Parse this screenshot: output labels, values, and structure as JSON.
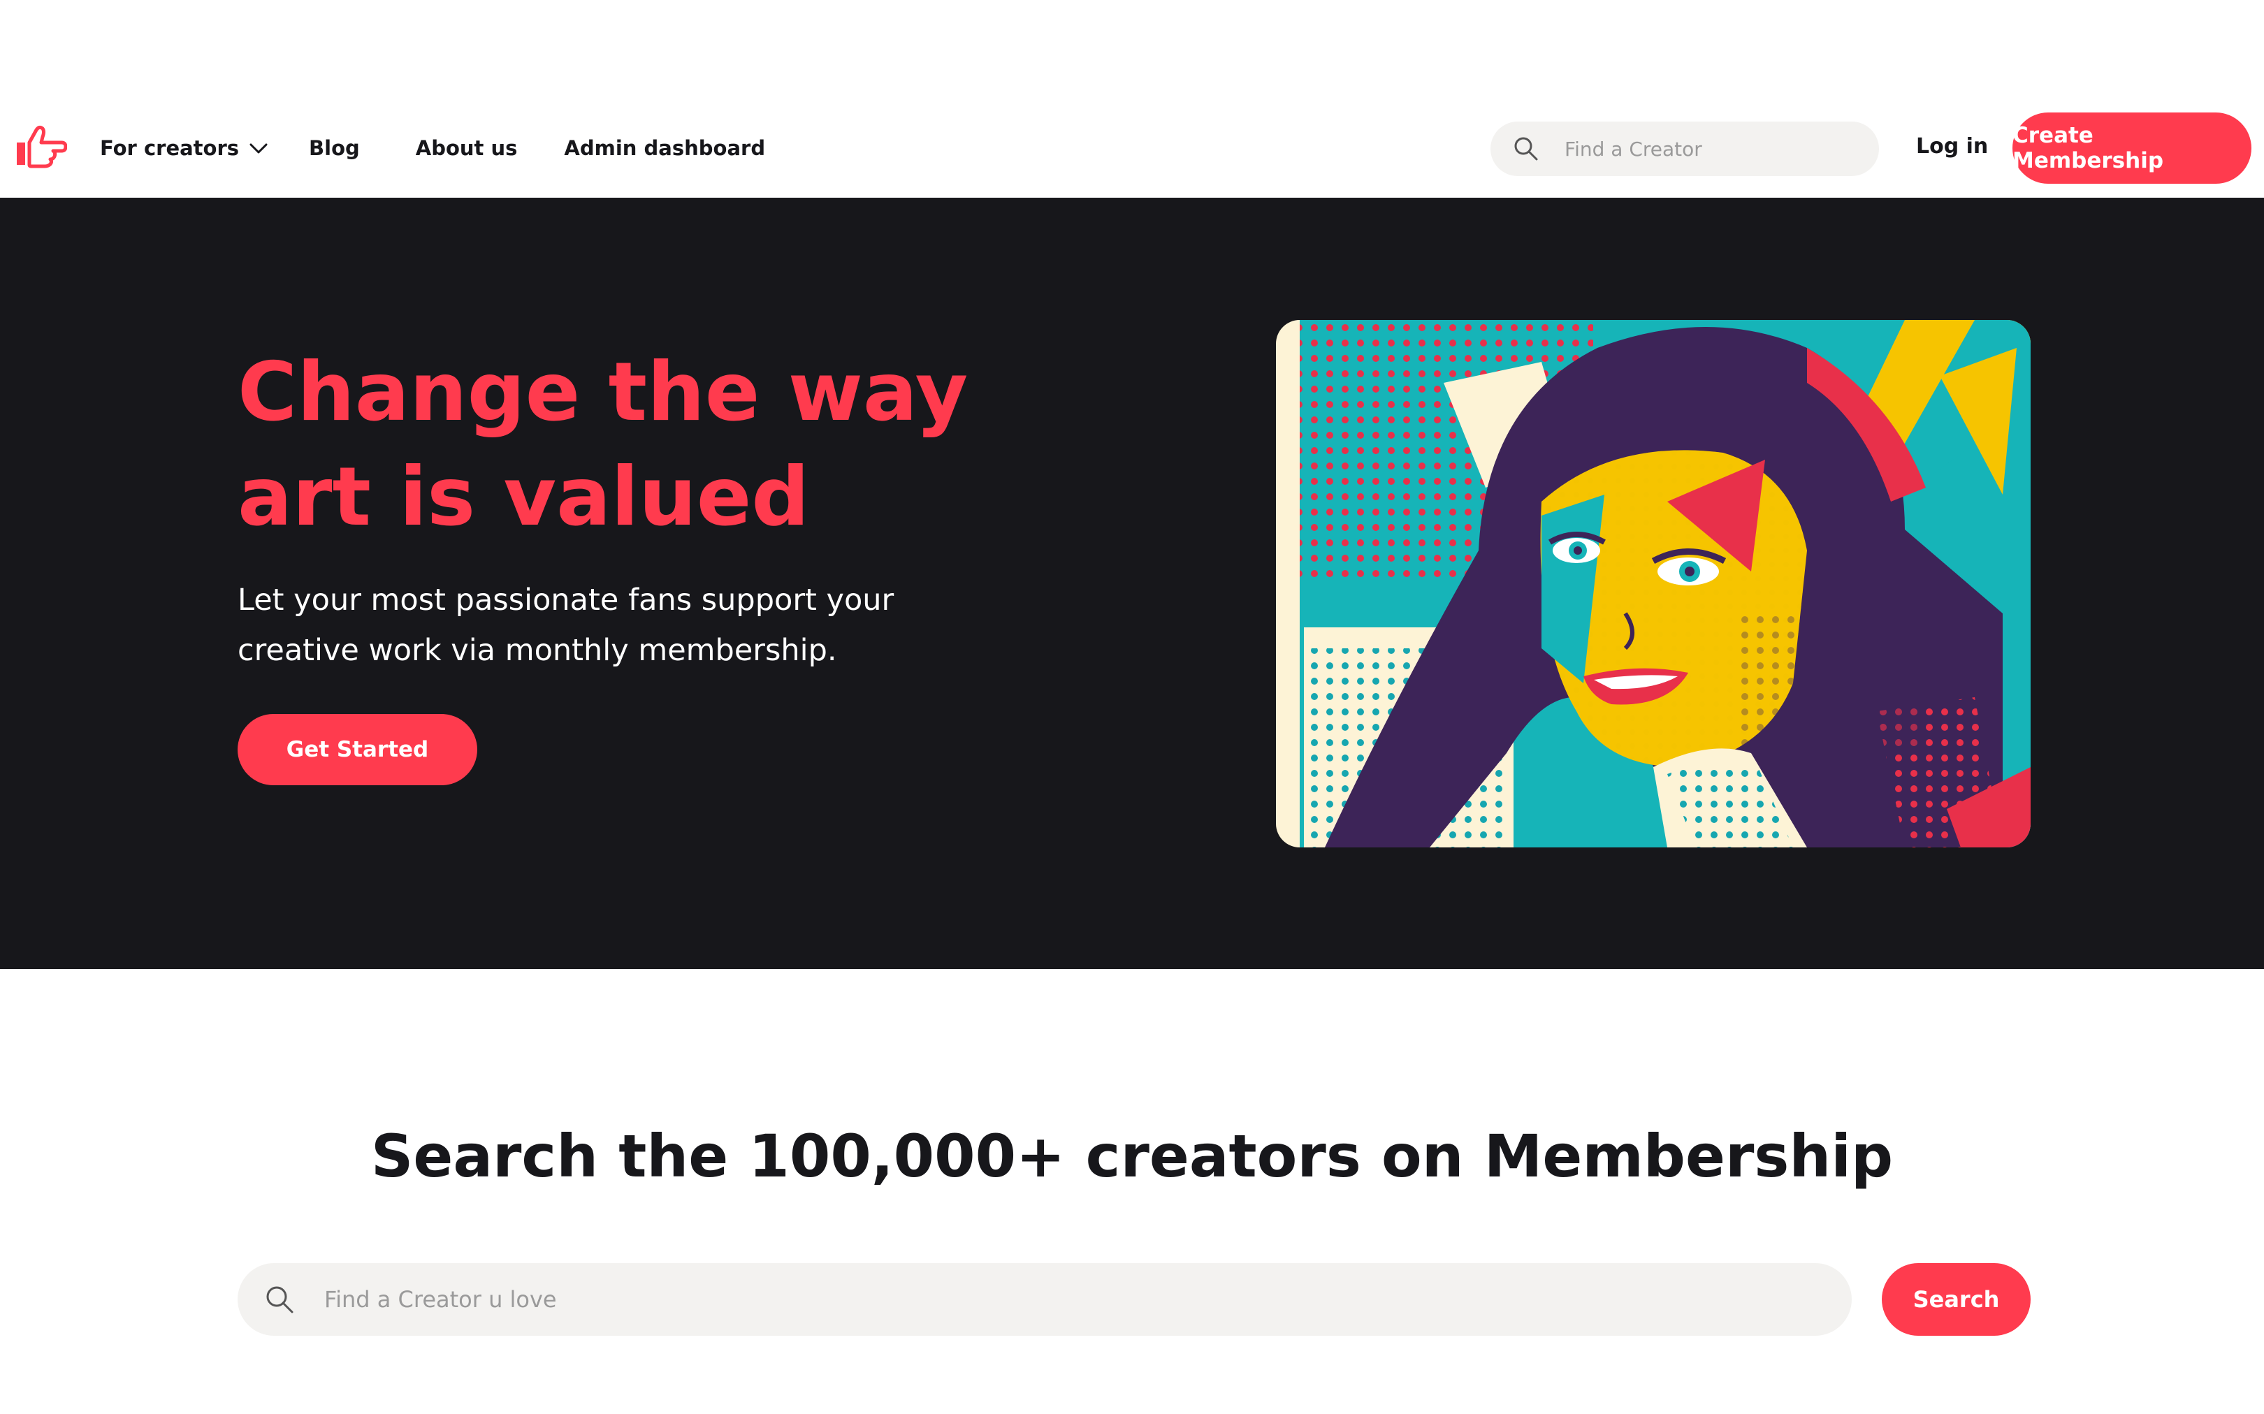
{
  "colors": {
    "accent": "#ff3b4e",
    "dark": "#17171b",
    "field": "#f3f2f0"
  },
  "header": {
    "logo_icon": "pointing-hand-icon",
    "nav": {
      "for_creators": "For creators",
      "blog": "Blog",
      "about": "About us",
      "admin": "Admin dashboard"
    },
    "search_placeholder": "Find a Creator",
    "login": "Log in",
    "create_membership": "Create Membership"
  },
  "hero": {
    "title_line1": "Change the way",
    "title_line2": "art is valued",
    "subtitle_line1": "Let your most passionate fans support your",
    "subtitle_line2": "creative work via monthly membership.",
    "cta": "Get Started",
    "image_icon": "pop-art-portrait-image"
  },
  "search_section": {
    "title": "Search the 100,000+ creators on Membership",
    "placeholder": "Find a Creator u love",
    "button": "Search"
  }
}
